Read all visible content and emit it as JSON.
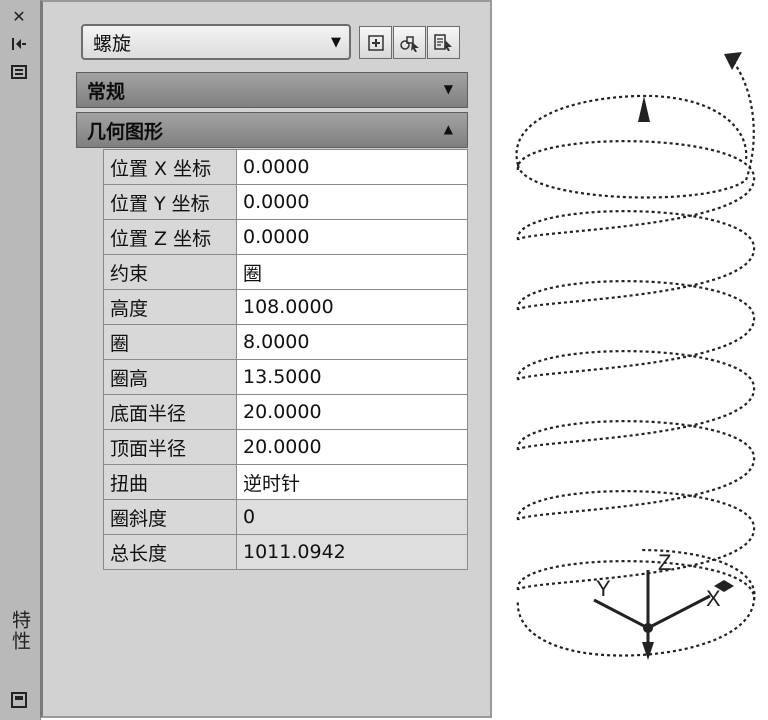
{
  "palette": {
    "vertical_title": "特性",
    "object_type": "螺旋",
    "sections": {
      "general": "常规",
      "geometry": "几何图形"
    },
    "properties": [
      {
        "label": "位置 X 坐标",
        "value": "0.0000"
      },
      {
        "label": "位置 Y 坐标",
        "value": "0.0000"
      },
      {
        "label": "位置 Z 坐标",
        "value": "0.0000"
      },
      {
        "label": "约束",
        "value": "圈"
      },
      {
        "label": "高度",
        "value": "108.0000"
      },
      {
        "label": "圈",
        "value": "8.0000"
      },
      {
        "label": "圈高",
        "value": "13.5000"
      },
      {
        "label": "底面半径",
        "value": "20.0000"
      },
      {
        "label": "顶面半径",
        "value": "20.0000"
      },
      {
        "label": "扭曲",
        "value": "逆时针"
      },
      {
        "label": "圈斜度",
        "value": "0"
      },
      {
        "label": "总长度",
        "value": "1011.0942"
      }
    ]
  },
  "ucs": {
    "x_label": "X",
    "y_label": "Y",
    "z_label": "Z"
  },
  "colors": {
    "panel_bg": "#d2d2d2",
    "section_header": "#8f8f8f",
    "helix_stroke": "#222222"
  }
}
